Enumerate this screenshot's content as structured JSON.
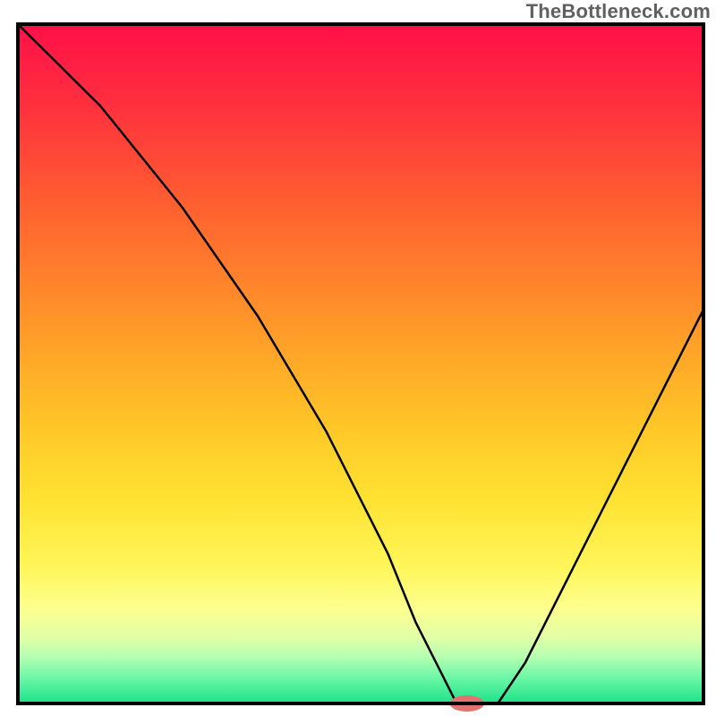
{
  "watermark": "TheBottleneck.com",
  "chart_data": {
    "type": "line",
    "title": "",
    "xlabel": "",
    "ylabel": "",
    "xlim": [
      0,
      100
    ],
    "ylim": [
      0,
      100
    ],
    "x": [
      0,
      12,
      24,
      35,
      45,
      54,
      58,
      62,
      64,
      67,
      70,
      74,
      80,
      88,
      96,
      100
    ],
    "values": [
      100,
      88,
      73,
      57,
      40,
      22,
      12,
      4,
      0,
      0,
      0,
      6,
      18,
      34,
      50,
      58
    ],
    "gradient_stops": [
      {
        "offset": 0,
        "color": "#ff1048"
      },
      {
        "offset": 10,
        "color": "#ff2a40"
      },
      {
        "offset": 20,
        "color": "#ff4a36"
      },
      {
        "offset": 30,
        "color": "#ff6a2e"
      },
      {
        "offset": 40,
        "color": "#ff8a2a"
      },
      {
        "offset": 50,
        "color": "#ffaa28"
      },
      {
        "offset": 60,
        "color": "#ffc828"
      },
      {
        "offset": 70,
        "color": "#ffe232"
      },
      {
        "offset": 80,
        "color": "#fff65a"
      },
      {
        "offset": 86,
        "color": "#fdff8e"
      },
      {
        "offset": 90,
        "color": "#e4ffa6"
      },
      {
        "offset": 93,
        "color": "#b8ffb0"
      },
      {
        "offset": 96,
        "color": "#70f8a8"
      },
      {
        "offset": 100,
        "color": "#1de28a"
      }
    ],
    "frame_color": "#000000",
    "line_color": "#000000",
    "line_width": 2.5,
    "marker": {
      "x": 65.5,
      "y": 0,
      "rx": 2.5,
      "ry": 1.2,
      "color": "#e2736f"
    }
  }
}
